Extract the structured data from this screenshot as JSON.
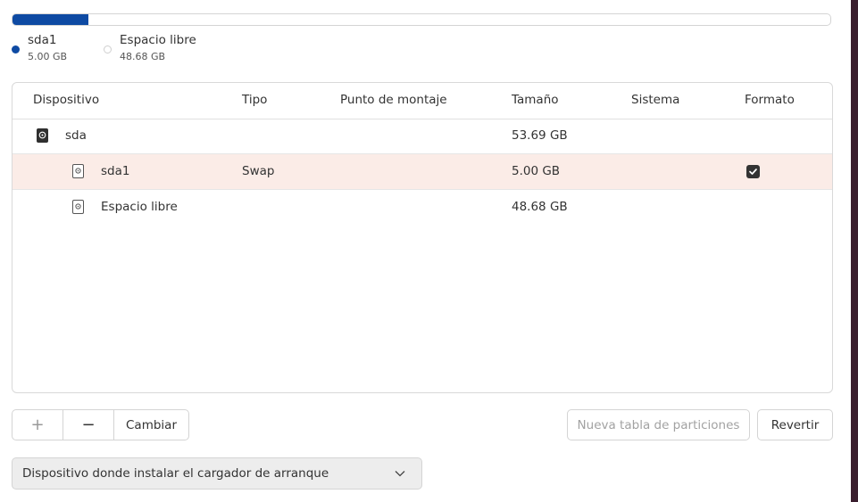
{
  "usage_bar": {
    "fill_fraction": 0.093,
    "fill_color": "#0e4aa3"
  },
  "legend": [
    {
      "name": "sda1",
      "size": "5.00 GB",
      "color": "#0e4aa3"
    },
    {
      "name": "Espacio libre",
      "size": "48.68 GB",
      "color": "#ffffff"
    }
  ],
  "table": {
    "columns": [
      "Dispositivo",
      "Tipo",
      "Punto de montaje",
      "Tamaño",
      "Sistema",
      "Formato"
    ],
    "rows": [
      {
        "device": "sda",
        "type": "",
        "mount": "",
        "size": "53.69 GB",
        "system": "",
        "format": false,
        "icon": "drive-icon",
        "selected": false
      },
      {
        "device": "sda1",
        "type": "Swap",
        "mount": "",
        "size": "5.00 GB",
        "system": "",
        "format": true,
        "icon": "partition-icon",
        "selected": true
      },
      {
        "device": "Espacio libre",
        "type": "",
        "mount": "",
        "size": "48.68 GB",
        "system": "",
        "format": false,
        "icon": "partition-icon",
        "selected": false
      }
    ]
  },
  "buttons": {
    "add": "+",
    "remove": "−",
    "change": "Cambiar",
    "new_table": "Nueva tabla de particiones",
    "revert": "Revertir"
  },
  "bootloader": {
    "label": "Dispositivo donde instalar el cargador de arranque"
  }
}
